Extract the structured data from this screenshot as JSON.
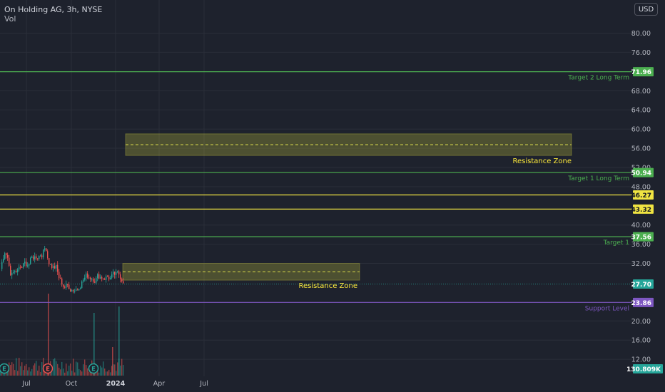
{
  "header": {
    "title": "On Holding AG, 3h, NYSE",
    "volume_label": "Vol"
  },
  "currency_button": "USD",
  "chart_data": {
    "type": "candlestick",
    "y_axis_ticks": [
      "80.00",
      "76.00",
      "68.00",
      "64.00",
      "60.00",
      "56.00",
      "52.00",
      "48.00",
      "40.00",
      "36.00",
      "32.00",
      "20.00",
      "16.00",
      "12.00"
    ],
    "x_axis_ticks": [
      "Jul",
      "Oct",
      "2024",
      "Apr",
      "Jul"
    ],
    "levels": [
      {
        "value": 71.96,
        "label": "Target 2 Long Term",
        "color": "#4caf50"
      },
      {
        "value": 50.94,
        "label": "Target 1 Long Term",
        "color": "#4caf50"
      },
      {
        "value": 46.27,
        "label": "",
        "color": "#f0e442"
      },
      {
        "value": 43.32,
        "label": "",
        "color": "#f0e442"
      },
      {
        "value": 37.56,
        "label": "Target 1",
        "color": "#4caf50"
      },
      {
        "value": 23.86,
        "label": "Support Level",
        "color": "#7e57c2"
      }
    ],
    "zones": [
      {
        "label": "Resistance Zone",
        "low": 54.5,
        "high": 59.0,
        "start": "2024-01",
        "end": "2024-12"
      },
      {
        "label": "Resistance Zone",
        "low": 28.5,
        "high": 32.0,
        "start": "2024-01",
        "end": "2024-06"
      }
    ],
    "last_price": "27.70",
    "volume_value": "130.809K",
    "earnings_markers": [
      "E",
      "E",
      "E"
    ],
    "colors": {
      "up": "#26a69a",
      "down": "#ef5350",
      "background": "#1e222d",
      "grid": "#2a2e39",
      "axis_text": "#b2b5be"
    }
  }
}
